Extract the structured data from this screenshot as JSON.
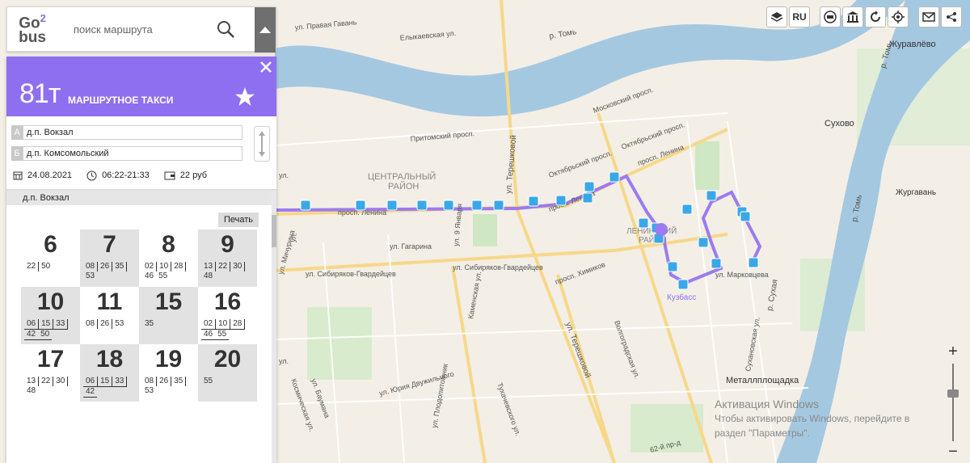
{
  "search": {
    "placeholder": "поиск маршрута"
  },
  "logo": {
    "line1": "Go",
    "line1_sup": "2",
    "line2": "bus"
  },
  "route": {
    "number": "81т",
    "type": "МАРШРУТНОЕ ТАКСИ",
    "accent_color": "#8e6ff0",
    "stop_a_letter": "А",
    "stop_a": "д.п. Вокзал",
    "stop_b_letter": "Б",
    "stop_b": "д.п. Комсомольский",
    "date": "24.08.2021",
    "hours": "06:22-21:33",
    "price": "22 руб",
    "current_stop": "д.п. Вокзал",
    "print_label": "Печать"
  },
  "schedule": [
    {
      "hour": "6",
      "shaded": false,
      "underlined": false,
      "minutes": [
        "22",
        "50"
      ]
    },
    {
      "hour": "7",
      "shaded": true,
      "underlined": false,
      "minutes": [
        "08",
        "26",
        "35",
        "53"
      ]
    },
    {
      "hour": "8",
      "shaded": false,
      "underlined": false,
      "minutes": [
        "02",
        "10",
        "28",
        "46",
        "55"
      ]
    },
    {
      "hour": "9",
      "shaded": true,
      "underlined": false,
      "minutes": [
        "13",
        "22",
        "30",
        "48"
      ]
    },
    {
      "hour": "10",
      "shaded": true,
      "underlined": true,
      "minutes": [
        "06",
        "15",
        "33",
        "42",
        "50"
      ]
    },
    {
      "hour": "11",
      "shaded": false,
      "underlined": false,
      "minutes": [
        "08",
        "26",
        "53"
      ]
    },
    {
      "hour": "15",
      "shaded": true,
      "underlined": false,
      "minutes": [
        "35"
      ]
    },
    {
      "hour": "16",
      "shaded": false,
      "underlined": true,
      "minutes": [
        "02",
        "10",
        "28",
        "46",
        "55"
      ]
    },
    {
      "hour": "17",
      "shaded": false,
      "underlined": false,
      "minutes": [
        "13",
        "22",
        "30",
        "48"
      ]
    },
    {
      "hour": "18",
      "shaded": true,
      "underlined": true,
      "minutes": [
        "06",
        "15",
        "33",
        "42"
      ]
    },
    {
      "hour": "19",
      "shaded": false,
      "underlined": false,
      "minutes": [
        "08",
        "26",
        "35",
        "53"
      ]
    },
    {
      "hour": "20",
      "shaded": true,
      "underlined": false,
      "minutes": [
        "55"
      ]
    }
  ],
  "toolbar": {
    "layers_icon": "layers-icon",
    "lang": "RU",
    "icons": [
      "car-icon",
      "museum-icon",
      "refresh-icon",
      "locate-icon"
    ],
    "mail_icon": "mail-icon",
    "share_icon": "share-icon"
  },
  "zoom": {
    "plus": "+",
    "minus": "−"
  },
  "map": {
    "river_label_1": "р. Томь",
    "river_label_2": "р. Томь",
    "river_label_3": "р. Томь",
    "river_label_4": "р. Сухая",
    "districts": [
      "ЦЕНТРАЛЬНЫЙ",
      "РАЙОН",
      "ЛЕНИНСКИЙ",
      "РАЙОН"
    ],
    "places": [
      "Журавлёво",
      "Сухово",
      "Жургавань",
      "Металлплощадка",
      "Кузбасс"
    ],
    "streets": [
      "ул. Правая Гавань",
      "Елыкаевская ул.",
      "Притомский просп.",
      "ул. Терешковой",
      "Московский просп.",
      "Октябрьский просп.",
      "Октябрьский просп.",
      "просп. Ленина",
      "просп. Ленина",
      "просп. Ленина",
      "ул. Гагарина",
      "ул. 9 Января",
      "ул. Сибиряков-Гвардейцев",
      "ул. Сибиряков-Гвардейцев",
      "просп. Химиков",
      "Каменская ул.",
      "ул. Терешковой",
      "Волгоградская ул.",
      "ул. Мичурина",
      "ул. Бауманa",
      "Космическая ул.",
      "ул. Юрия Двужильного",
      "Тухачевского ул.",
      "ул. Плодопитомник",
      "ул. Марковцева",
      "Сухановская ул.",
      "62-й пр-д",
      "ул.",
      "ул.",
      "ул."
    ]
  },
  "watermark": {
    "title": "Активация Windows",
    "line1": "Чтобы активировать Windows, перейдите в",
    "line2": "раздел \"Параметры\"."
  }
}
